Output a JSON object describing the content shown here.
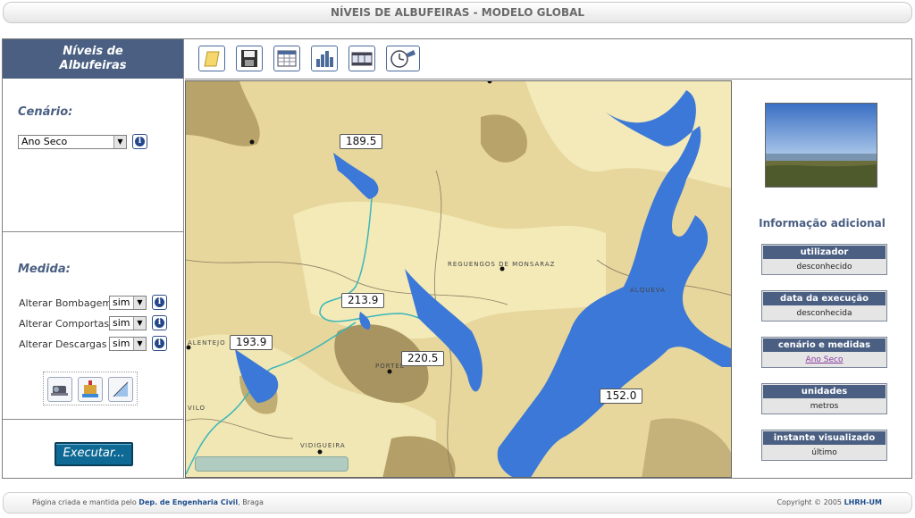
{
  "window": {
    "title": "NÍVEIS DE ALBUFEIRAS - MODELO GLOBAL"
  },
  "sidebar": {
    "header_line1": "Níveis de",
    "header_line2": "Albufeiras",
    "scenario": {
      "title": "Cenário:",
      "selected": "Ano Seco"
    },
    "measure": {
      "title": "Medida:",
      "rows": [
        {
          "label": "Alterar Bombagem",
          "value": "sim"
        },
        {
          "label": "Alterar Comportas",
          "value": "sim"
        },
        {
          "label": "Alterar Descargas",
          "value": "sim"
        }
      ]
    },
    "run_label": "Executar..."
  },
  "toolbar": {
    "icons": [
      "open-icon",
      "save-icon",
      "table-icon",
      "bar-chart-icon",
      "film-icon",
      "clock-icon"
    ]
  },
  "map": {
    "labels": [
      "189.5",
      "213.9",
      "193.9",
      "220.5",
      "152.0"
    ],
    "places": [
      "REGUENGOS DE MONSARAZ",
      "ALENTEJO",
      "VILO",
      "VIDIGUEIRA",
      "PORTEL",
      "ALQUEVA"
    ]
  },
  "info": {
    "title": "Informação adicional",
    "boxes": [
      {
        "header": "utilizador",
        "value": "desconhecido"
      },
      {
        "header": "data da execução",
        "value": "desconhecida"
      },
      {
        "header": "cenário e medidas",
        "value": "Ano Seco"
      },
      {
        "header": "unidades",
        "value": "metros"
      },
      {
        "header": "instante visualizado",
        "value": "último"
      }
    ]
  },
  "footer": {
    "left_prefix": "Página criada e mantida pelo",
    "left_link": "Dep. de Engenharia Civil",
    "left_suffix": ", Braga",
    "right_prefix": "Copyright © 2005",
    "right_link": "LHRH-UM"
  },
  "colors": {
    "accent": "#4a5f82",
    "water": "#3c78d8",
    "land": "#e8d9a0",
    "run_button": "#0e6a94"
  }
}
